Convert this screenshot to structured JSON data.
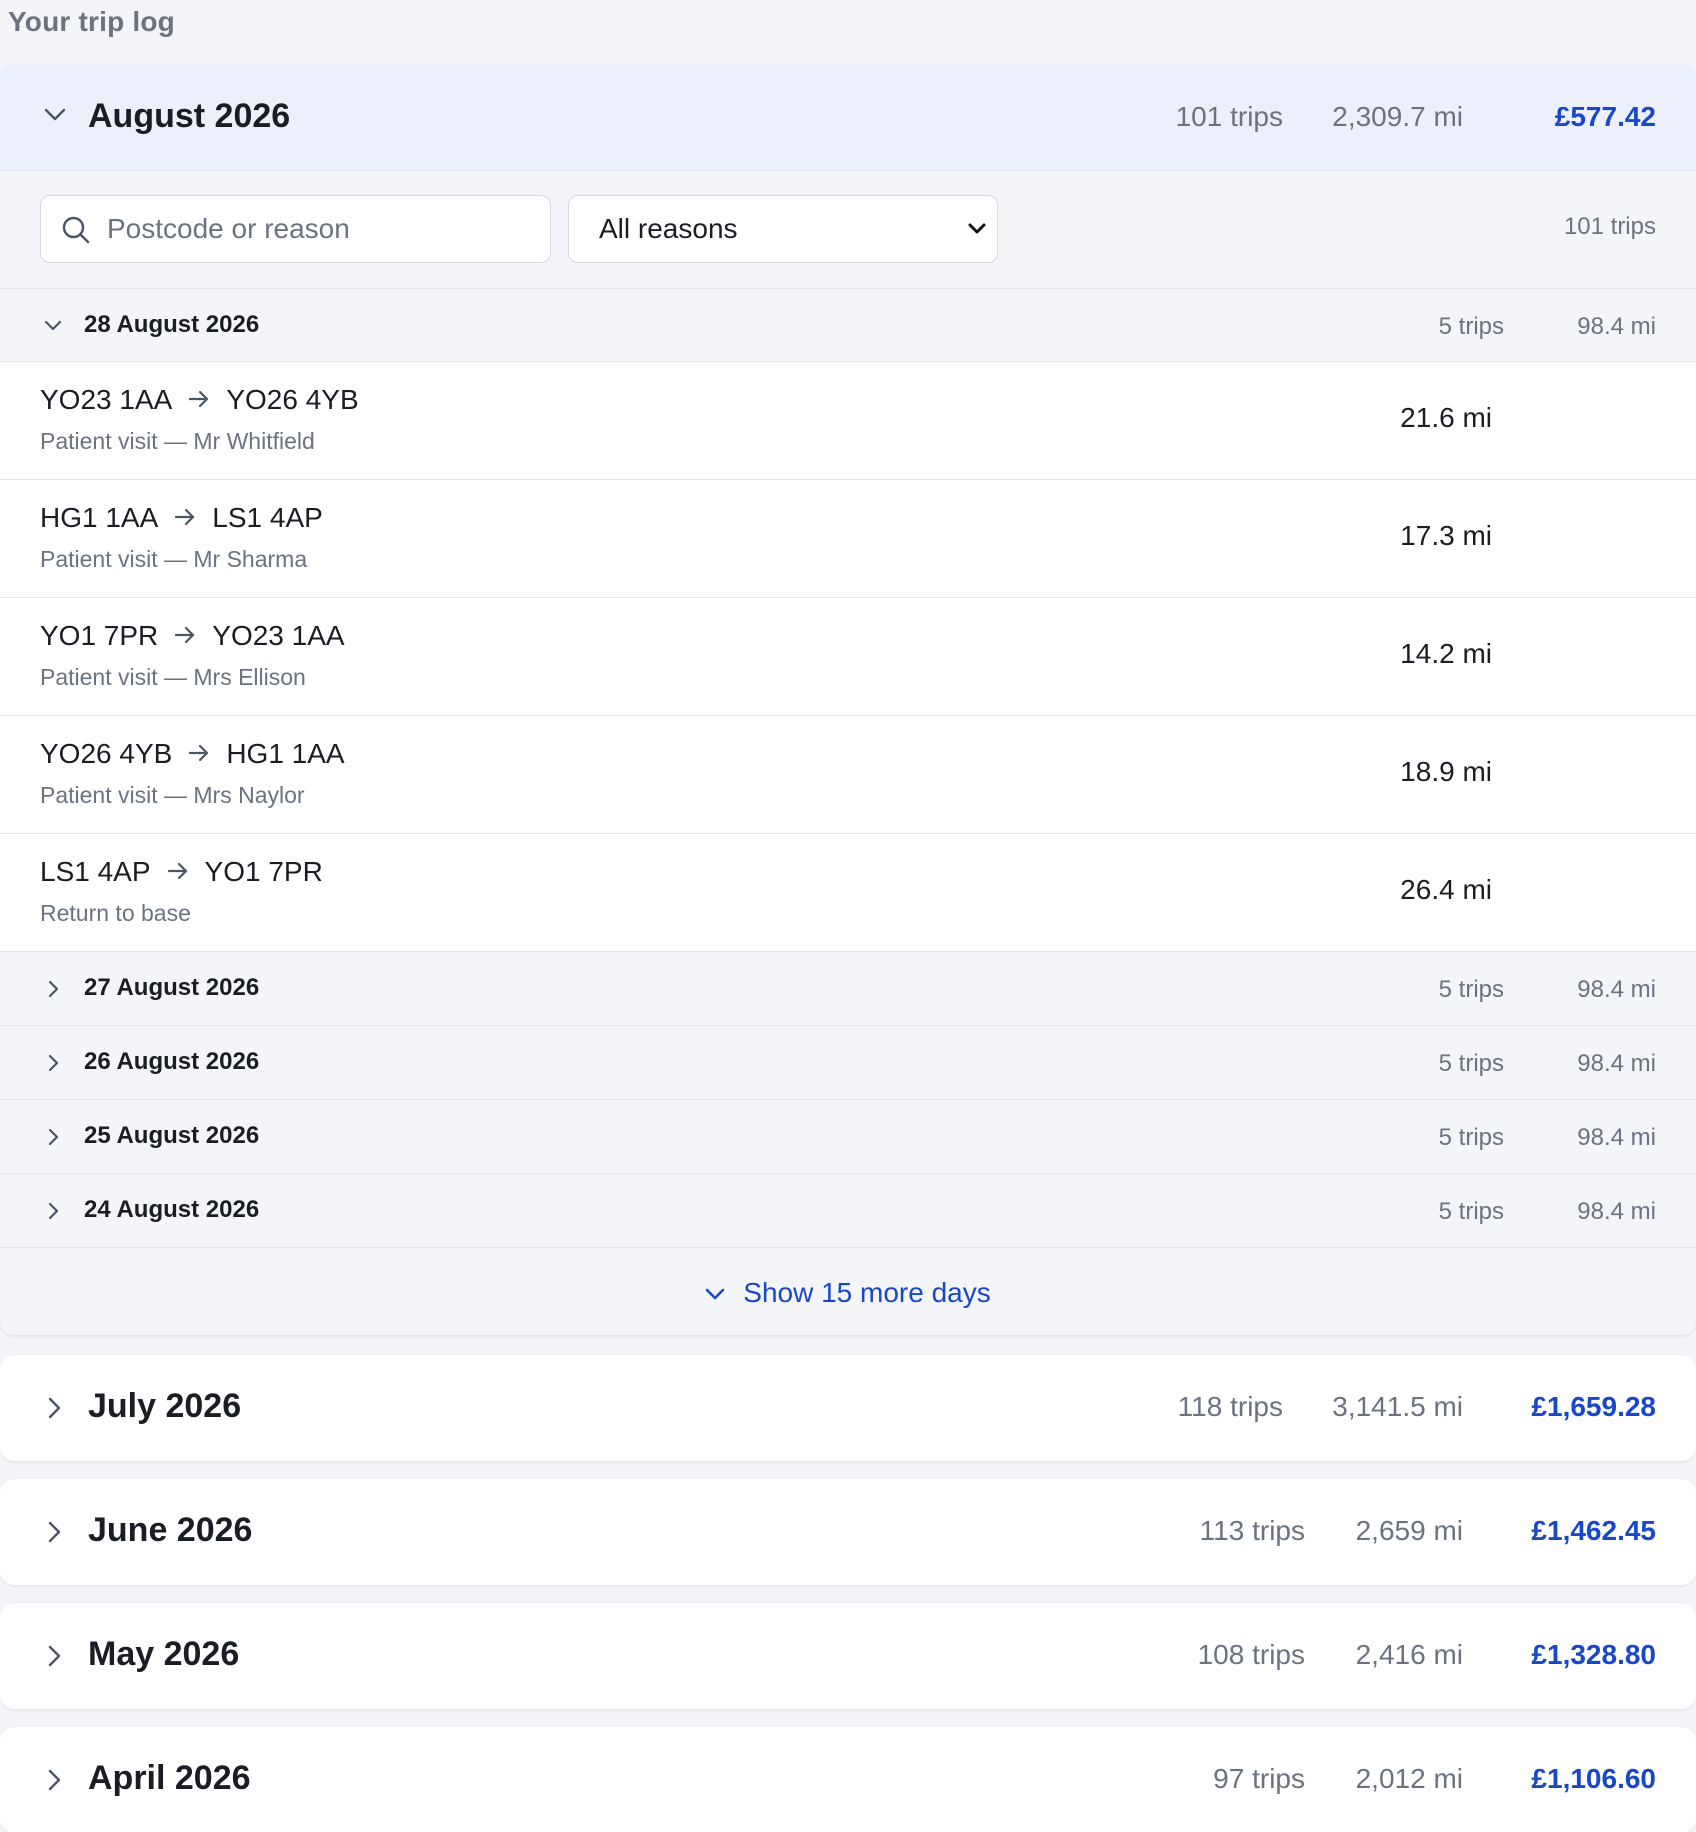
{
  "page": {
    "heading": "Your trip log"
  },
  "current_month": {
    "title": "August 2026",
    "trips": "101 trips",
    "miles": "2,309.7 mi",
    "amount": "£577.42"
  },
  "filters": {
    "search_placeholder": "Postcode or reason",
    "search_value": "",
    "reason_selected": "All reasons",
    "count": "101 trips"
  },
  "open_day": {
    "title": "28 August 2026",
    "trips": "5 trips",
    "miles": "98.4 mi",
    "trips_list": [
      {
        "from": "YO23 1AA",
        "to": "YO26 4YB",
        "reason": "Patient visit — Mr Whitfield",
        "miles": "21.6 mi"
      },
      {
        "from": "HG1 1AA",
        "to": "LS1 4AP",
        "reason": "Patient visit — Mr Sharma",
        "miles": "17.3 mi"
      },
      {
        "from": "YO1 7PR",
        "to": "YO23 1AA",
        "reason": "Patient visit — Mrs Ellison",
        "miles": "14.2 mi"
      },
      {
        "from": "YO26 4YB",
        "to": "HG1 1AA",
        "reason": "Patient visit — Mrs Naylor",
        "miles": "18.9 mi"
      },
      {
        "from": "LS1 4AP",
        "to": "YO1 7PR",
        "reason": "Return to base",
        "miles": "26.4 mi"
      }
    ]
  },
  "collapsed_days": [
    {
      "title": "27 August 2026",
      "trips": "5 trips",
      "miles": "98.4 mi"
    },
    {
      "title": "26 August 2026",
      "trips": "5 trips",
      "miles": "98.4 mi"
    },
    {
      "title": "25 August 2026",
      "trips": "5 trips",
      "miles": "98.4 mi"
    },
    {
      "title": "24 August 2026",
      "trips": "5 trips",
      "miles": "98.4 mi"
    }
  ],
  "show_more_label": "Show 15 more days",
  "other_months": [
    {
      "title": "July 2026",
      "trips": "118 trips",
      "miles": "3,141.5 mi",
      "amount": "£1,659.28"
    },
    {
      "title": "June 2026",
      "trips": "113 trips",
      "miles": "2,659 mi",
      "amount": "£1,462.45"
    },
    {
      "title": "May 2026",
      "trips": "108 trips",
      "miles": "2,416 mi",
      "amount": "£1,328.80"
    },
    {
      "title": "April 2026",
      "trips": "97 trips",
      "miles": "2,012 mi",
      "amount": "£1,106.60"
    }
  ],
  "colors": {
    "accent": "#1848c8",
    "header_bg": "#ebf0fb",
    "page_bg": "#f4f5f8",
    "muted_text": "#6b7280"
  },
  "icons": {
    "expand": "chevron-down-icon",
    "collapse": "chevron-right-icon",
    "search": "search-icon",
    "route": "arrow-right-icon"
  }
}
